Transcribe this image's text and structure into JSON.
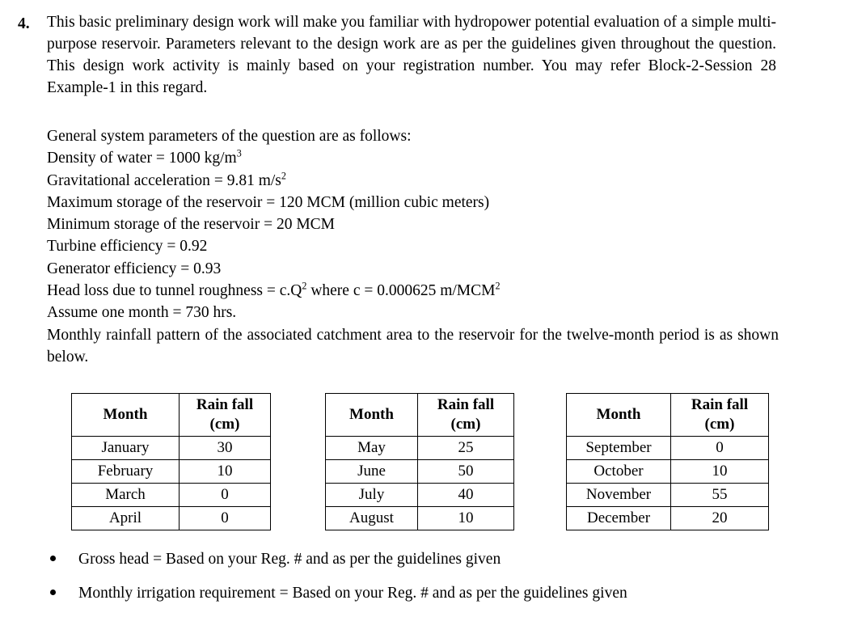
{
  "question": {
    "number": "4.",
    "body": "This basic preliminary design work will make you familiar with hydropower potential evaluation of a simple multi-purpose reservoir. Parameters relevant to the design work are as per the guidelines given throughout the question. This design work activity is mainly based on your registration number. You may refer Block-2-Session 28 Example-1 in this regard."
  },
  "parameters": {
    "intro": "General system parameters of the question are as follows:",
    "lines": [
      {
        "label": "Density of water",
        "separator": " = ",
        "value": "1000 kg/m",
        "superscript": "3"
      },
      {
        "label": "Gravitational acceleration",
        "separator": " = ",
        "value": "9.81 m/s",
        "superscript": "2"
      },
      {
        "label": "Maximum storage of the reservoir",
        "separator": " = ",
        "value": "120 MCM (million cubic meters)",
        "superscript": ""
      },
      {
        "label": "Minimum storage of the reservoir",
        "separator": " = ",
        "value": "20 MCM",
        "superscript": ""
      },
      {
        "label": "Turbine efficiency",
        "separator": " = ",
        "value": "0.92",
        "superscript": ""
      },
      {
        "label": "Generator efficiency",
        "separator": " = ",
        "value": "0.93",
        "superscript": ""
      }
    ],
    "head_loss": {
      "label": "Head loss due to tunnel roughness",
      "separator": " = ",
      "expr_base": "c.Q",
      "expr_sup": "2",
      "middle": " where c = 0.000625 m/MCM",
      "tail_sup": "2"
    },
    "assume_month": "Assume one month = 730 hrs.",
    "rainfall_note": "Monthly rainfall pattern of the associated catchment area to the reservoir for the twelve-month period is as shown below."
  },
  "tables": {
    "headers": {
      "month": "Month",
      "rainfall_line1": "Rain fall",
      "rainfall_line2": "(cm)"
    },
    "groups": [
      {
        "id": "table-1",
        "rows": [
          {
            "month": "January",
            "rainfall": "30"
          },
          {
            "month": "February",
            "rainfall": "10"
          },
          {
            "month": "March",
            "rainfall": "0"
          },
          {
            "month": "April",
            "rainfall": "0"
          }
        ]
      },
      {
        "id": "table-2",
        "rows": [
          {
            "month": "May",
            "rainfall": "25"
          },
          {
            "month": "June",
            "rainfall": "50"
          },
          {
            "month": "July",
            "rainfall": "40"
          },
          {
            "month": "August",
            "rainfall": "10"
          }
        ]
      },
      {
        "id": "table-3",
        "rows": [
          {
            "month": "September",
            "rainfall": "0"
          },
          {
            "month": "October",
            "rainfall": "10"
          },
          {
            "month": "November",
            "rainfall": "55"
          },
          {
            "month": "December",
            "rainfall": "20"
          }
        ]
      }
    ]
  },
  "bullets": [
    "Gross head = Based on your Reg. # and as per the guidelines given",
    "Monthly irrigation requirement = Based on your Reg. # and as per the guidelines given"
  ]
}
